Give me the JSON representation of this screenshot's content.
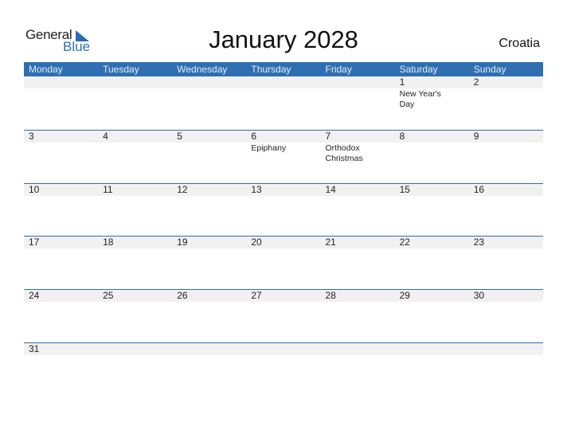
{
  "brand": {
    "general": "General",
    "blue": "Blue"
  },
  "title": "January 2028",
  "country": "Croatia",
  "weekdays": [
    "Monday",
    "Tuesday",
    "Wednesday",
    "Thursday",
    "Friday",
    "Saturday",
    "Sunday"
  ],
  "weeks": [
    [
      {
        "day": ""
      },
      {
        "day": ""
      },
      {
        "day": ""
      },
      {
        "day": ""
      },
      {
        "day": ""
      },
      {
        "day": "1",
        "holiday": "New Year's Day"
      },
      {
        "day": "2"
      }
    ],
    [
      {
        "day": "3"
      },
      {
        "day": "4"
      },
      {
        "day": "5"
      },
      {
        "day": "6",
        "holiday": "Epiphany"
      },
      {
        "day": "7",
        "holiday": "Orthodox Christmas"
      },
      {
        "day": "8"
      },
      {
        "day": "9"
      }
    ],
    [
      {
        "day": "10"
      },
      {
        "day": "11"
      },
      {
        "day": "12"
      },
      {
        "day": "13"
      },
      {
        "day": "14"
      },
      {
        "day": "15"
      },
      {
        "day": "16"
      }
    ],
    [
      {
        "day": "17"
      },
      {
        "day": "18"
      },
      {
        "day": "19"
      },
      {
        "day": "20"
      },
      {
        "day": "21"
      },
      {
        "day": "22"
      },
      {
        "day": "23"
      }
    ],
    [
      {
        "day": "24"
      },
      {
        "day": "25"
      },
      {
        "day": "26"
      },
      {
        "day": "27"
      },
      {
        "day": "28"
      },
      {
        "day": "29"
      },
      {
        "day": "30"
      }
    ],
    [
      {
        "day": "31"
      },
      {
        "day": ""
      },
      {
        "day": ""
      },
      {
        "day": ""
      },
      {
        "day": ""
      },
      {
        "day": ""
      },
      {
        "day": ""
      }
    ]
  ]
}
